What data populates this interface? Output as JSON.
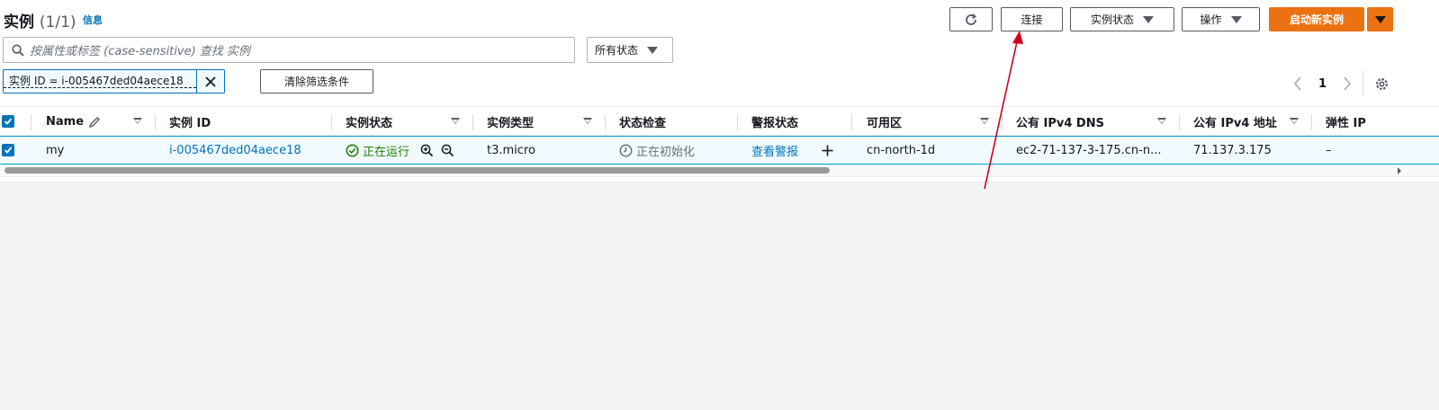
{
  "header": {
    "title": "实例",
    "count": "(1/1)",
    "info_link": "信息"
  },
  "toolbar": {
    "refresh_icon": "refresh-icon",
    "connect_label": "连接",
    "instance_state_label": "实例状态",
    "actions_label": "操作",
    "launch_label": "启动新实例"
  },
  "search": {
    "placeholder": "按属性或标签 (case-sensitive) 查找 实例"
  },
  "state_filter": {
    "selected": "所有状态"
  },
  "filter_token": {
    "text": "实例 ID = i-005467ded04aece18"
  },
  "clear_filters_label": "清除筛选条件",
  "pagination": {
    "current_page": "1"
  },
  "table": {
    "columns": [
      "Name",
      "实例 ID",
      "实例状态",
      "实例类型",
      "状态检查",
      "警报状态",
      "可用区",
      "公有 IPv4 DNS",
      "公有 IPv4 地址",
      "弹性 IP"
    ],
    "rows": [
      {
        "name": "my",
        "instance_id": "i-005467ded04aece18",
        "state": "正在运行",
        "type": "t3.micro",
        "status_check": "正在初始化",
        "alarm": "查看警报",
        "az": "cn-north-1d",
        "public_dns": "ec2-71-137-3-175.cn-n...",
        "public_ip": "71.137.3.175",
        "elastic_ip": "–"
      }
    ]
  },
  "colors": {
    "accent": "#0073bb",
    "primary_button": "#ec7211",
    "running": "#1d8102",
    "annotation_arrow": "#d0021b"
  }
}
